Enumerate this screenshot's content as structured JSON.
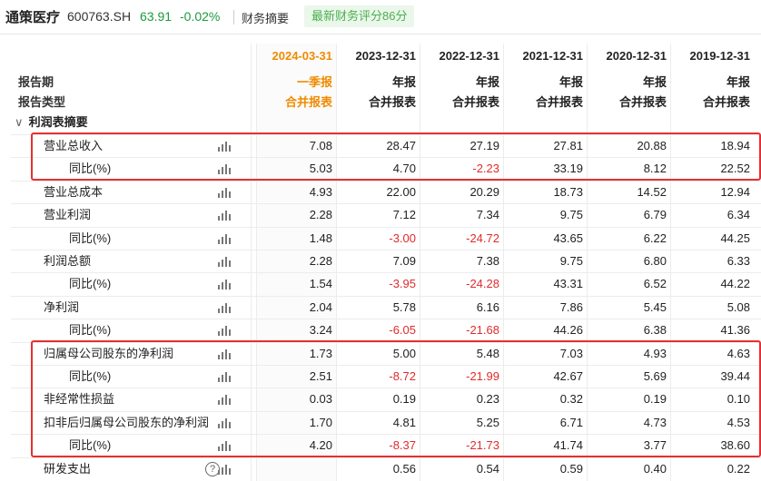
{
  "header": {
    "stock_name": "通策医疗",
    "stock_code": "600763.SH",
    "price": "63.91",
    "change": "-0.02%",
    "tab_summary": "财务摘要",
    "score_badge": "最新财务评分86分"
  },
  "table": {
    "label_period": "报告期",
    "label_type": "报告类型",
    "section_title": "利润表摘要",
    "columns": [
      {
        "date": "2024-03-31",
        "type": "一季报",
        "merge": "合并报表"
      },
      {
        "date": "2023-12-31",
        "type": "年报",
        "merge": "合并报表"
      },
      {
        "date": "2022-12-31",
        "type": "年报",
        "merge": "合并报表"
      },
      {
        "date": "2021-12-31",
        "type": "年报",
        "merge": "合并报表"
      },
      {
        "date": "2020-12-31",
        "type": "年报",
        "merge": "合并报表"
      },
      {
        "date": "2019-12-31",
        "type": "年报",
        "merge": "合并报表"
      }
    ],
    "rows": [
      {
        "label": "营业总收入",
        "values": [
          "7.08",
          "28.47",
          "27.19",
          "27.81",
          "20.88",
          "18.94"
        ]
      },
      {
        "label": "同比(%)",
        "values": [
          "5.03",
          "4.70",
          "-2.23",
          "33.19",
          "8.12",
          "22.52"
        ]
      },
      {
        "label": "营业总成本",
        "values": [
          "4.93",
          "22.00",
          "20.29",
          "18.73",
          "14.52",
          "12.94"
        ]
      },
      {
        "label": "营业利润",
        "values": [
          "2.28",
          "7.12",
          "7.34",
          "9.75",
          "6.79",
          "6.34"
        ]
      },
      {
        "label": "同比(%)",
        "values": [
          "1.48",
          "-3.00",
          "-24.72",
          "43.65",
          "6.22",
          "44.25"
        ]
      },
      {
        "label": "利润总额",
        "values": [
          "2.28",
          "7.09",
          "7.38",
          "9.75",
          "6.80",
          "6.33"
        ]
      },
      {
        "label": "同比(%)",
        "values": [
          "1.54",
          "-3.95",
          "-24.28",
          "43.31",
          "6.52",
          "44.22"
        ]
      },
      {
        "label": "净利润",
        "values": [
          "2.04",
          "5.78",
          "6.16",
          "7.86",
          "5.45",
          "5.08"
        ]
      },
      {
        "label": "同比(%)",
        "values": [
          "3.24",
          "-6.05",
          "-21.68",
          "44.26",
          "6.38",
          "41.36"
        ]
      },
      {
        "label": "归属母公司股东的净利润",
        "values": [
          "1.73",
          "5.00",
          "5.48",
          "7.03",
          "4.93",
          "4.63"
        ]
      },
      {
        "label": "同比(%)",
        "values": [
          "2.51",
          "-8.72",
          "-21.99",
          "42.67",
          "5.69",
          "39.44"
        ]
      },
      {
        "label": "非经常性损益",
        "values": [
          "0.03",
          "0.19",
          "0.23",
          "0.32",
          "0.19",
          "0.10"
        ]
      },
      {
        "label": "扣非后归属母公司股东的净利润",
        "values": [
          "1.70",
          "4.81",
          "5.25",
          "6.71",
          "4.73",
          "4.53"
        ]
      },
      {
        "label": "同比(%)",
        "values": [
          "4.20",
          "-8.37",
          "-21.73",
          "41.74",
          "3.77",
          "38.60"
        ]
      },
      {
        "label": "研发支出",
        "values": [
          "",
          "0.56",
          "0.54",
          "0.59",
          "0.40",
          "0.22"
        ]
      }
    ],
    "help_icon": "?"
  },
  "colors": {
    "up": "#222222",
    "down": "#e02b2b",
    "current_column": "#f08b00",
    "price_green": "#1a9b3c",
    "highlight_box": "#e53030"
  }
}
